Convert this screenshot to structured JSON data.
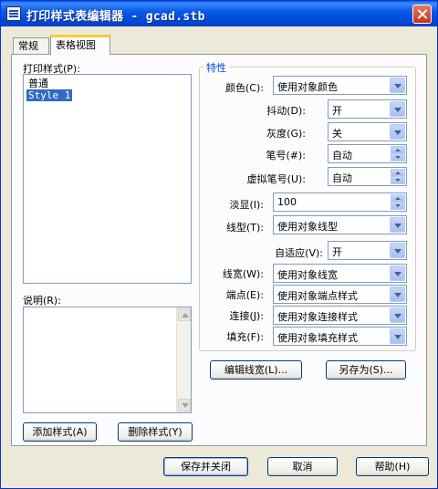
{
  "window": {
    "title": "打印样式表编辑器 - gcad.stb"
  },
  "tabs": [
    {
      "label": "常规",
      "active": false
    },
    {
      "label": "表格视图",
      "active": true
    }
  ],
  "left": {
    "styles_label": "打印样式(P):",
    "styles": [
      "普通",
      "Style 1"
    ],
    "selected_index": 1,
    "description_label": "说明(R):",
    "description_value": ""
  },
  "properties": {
    "group_title": "特性",
    "rows": [
      {
        "label": "颜色(C):",
        "value": "使用对象颜色",
        "control": "combo"
      },
      {
        "label": "抖动(D):",
        "value": "开",
        "control": "combo"
      },
      {
        "label": "灰度(G):",
        "value": "关",
        "control": "combo"
      },
      {
        "label": "笔号(#):",
        "value": "自动",
        "control": "spin"
      },
      {
        "label": "虚拟笔号(U):",
        "value": "自动",
        "control": "spin"
      },
      {
        "label": "淡显(I):",
        "value": "100",
        "control": "spin"
      },
      {
        "label": "线型(T):",
        "value": "使用对象线型",
        "control": "combo"
      },
      {
        "label": "自适应(V):",
        "value": "开",
        "control": "combo"
      },
      {
        "label": "线宽(W):",
        "value": "使用对象线宽",
        "control": "combo"
      },
      {
        "label": "端点(E):",
        "value": "使用对象端点样式",
        "control": "combo"
      },
      {
        "label": "连接(J):",
        "value": "使用对象连接样式",
        "control": "combo"
      },
      {
        "label": "填充(F):",
        "value": "使用对象填充样式",
        "control": "combo"
      }
    ],
    "edit_lineweights": "编辑线宽(L)...",
    "save_as": "另存为(S)..."
  },
  "left_buttons": {
    "add_style": "添加样式(A)",
    "delete_style": "删除样式(Y)"
  },
  "bottom_buttons": {
    "save_close": "保存并关闭",
    "cancel": "取消",
    "help": "帮助(H)"
  },
  "colors": {
    "title_bar": "#0a5ae8",
    "selection": "#316ac5",
    "group_title": "#0046d5"
  }
}
